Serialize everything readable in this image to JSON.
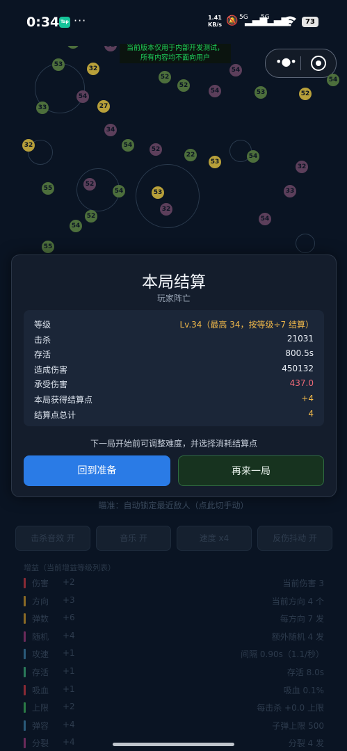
{
  "status_bar": {
    "time": "0:34",
    "app_badge": "Tap",
    "more": "···",
    "net_speed_value": "1.41",
    "net_speed_unit": "KB/s",
    "sim1": "5G",
    "sim2": "5G",
    "battery": "73"
  },
  "notice": {
    "line1": "当前版本仅用于内部开发测试，",
    "line2": "所有内容均不面向用户"
  },
  "capsule": {
    "more_icon": "more-dots-icon",
    "close_icon": "record-circle-icon"
  },
  "result": {
    "title": "本局结算",
    "subtitle": "玩家阵亡",
    "rows": [
      {
        "label": "等级",
        "value": "Lv.34（最高 34，按等级÷7 结算）",
        "color": "#f0b84a"
      },
      {
        "label": "击杀",
        "value": "21031",
        "color": "#e8edf4"
      },
      {
        "label": "存活",
        "value": "800.5s",
        "color": "#e8edf4"
      },
      {
        "label": "造成伤害",
        "value": "450132",
        "color": "#e8edf4"
      },
      {
        "label": "承受伤害",
        "value": "437.0",
        "color": "#f06a78"
      },
      {
        "label": "本局获得结算点",
        "value": "+4",
        "color": "#f0b84a"
      },
      {
        "label": "结算点总计",
        "value": "4",
        "color": "#f0b84a"
      }
    ],
    "hint": "下一局开始前可调整难度，并选择消耗结算点",
    "back_button": "回到准备",
    "again_button": "再来一局"
  },
  "background": {
    "aim_text": "瞄准：自动锁定最近敌人（点此切手动）",
    "controls": [
      "击杀音效 开",
      "音乐 开",
      "速度 x4",
      "反伤抖动 开"
    ],
    "upgrades_title": "增益（当前增益等级列表）",
    "upgrades": [
      {
        "name": "伤害",
        "add": "+2",
        "stat": "当前伤害 3",
        "color": "#8a2a35"
      },
      {
        "name": "方向",
        "add": "+3",
        "stat": "当前方向 4 个",
        "color": "#8a6a25"
      },
      {
        "name": "弹数",
        "add": "+6",
        "stat": "每方向 7 发",
        "color": "#8a6a25"
      },
      {
        "name": "随机",
        "add": "+4",
        "stat": "额外随机 4 发",
        "color": "#6a2a5a"
      },
      {
        "name": "攻速",
        "add": "+1",
        "stat": "间隔 0.90s（1.1/秒）",
        "color": "#2a5a7a"
      },
      {
        "name": "存活",
        "add": "+1",
        "stat": "存活 8.0s",
        "color": "#2a7a5a"
      },
      {
        "name": "吸血",
        "add": "+1",
        "stat": "吸血 0.1%",
        "color": "#8a2a35"
      },
      {
        "name": "上限",
        "add": "+2",
        "stat": "每击杀 +0.0 上限",
        "color": "#2a7a45"
      },
      {
        "name": "弹容",
        "add": "+4",
        "stat": "子弹上限 500",
        "color": "#2a5a7a"
      },
      {
        "name": "分裂",
        "add": "+4",
        "stat": "分裂 4 发",
        "color": "#6a2a5a"
      }
    ],
    "enemy_labels": [
      "54",
      "52",
      "32",
      "53",
      "54",
      "52",
      "33",
      "54",
      "27",
      "52",
      "54",
      "53",
      "52",
      "54",
      "34",
      "32",
      "54",
      "52",
      "22",
      "53",
      "54",
      "32",
      "55",
      "52",
      "54",
      "53",
      "33",
      "54",
      "52",
      "32",
      "54",
      "55"
    ]
  }
}
